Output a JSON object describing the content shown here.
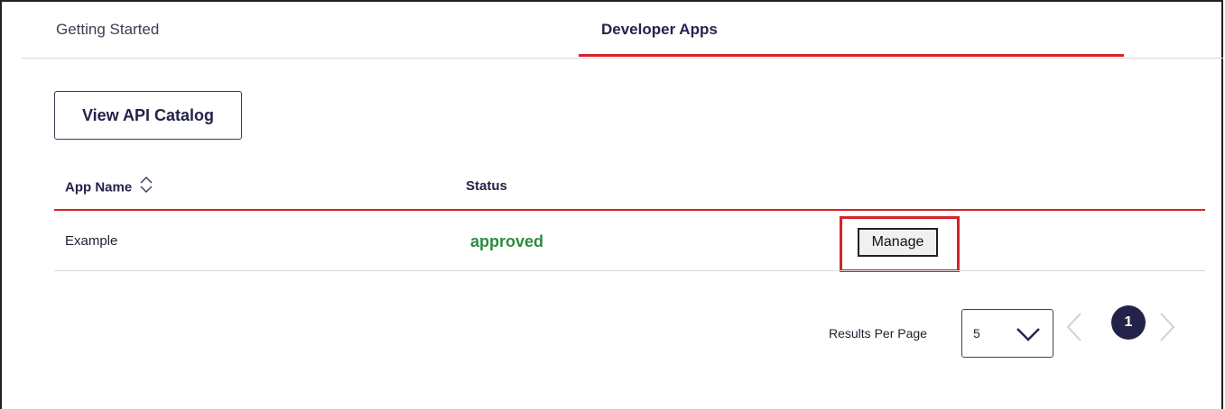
{
  "tabs": [
    {
      "label": "Getting Started",
      "active": false
    },
    {
      "label": "Developer Apps",
      "active": true
    }
  ],
  "catalog_button": "View API Catalog",
  "table": {
    "headers": {
      "app_name": "App Name",
      "status": "Status"
    },
    "rows": [
      {
        "app_name": "Example",
        "status": "approved",
        "action": "Manage"
      }
    ]
  },
  "pagination": {
    "results_per_page_label": "Results Per Page",
    "results_per_page_value": "5",
    "current_page": "1"
  },
  "icons": {
    "sort": "sort-up-down-icon",
    "dropdown": "chevron-down-icon",
    "prev": "chevron-left-icon",
    "next": "chevron-right-icon"
  },
  "colors": {
    "accent": "#d6232a",
    "navy": "#23234a",
    "approved": "#2e8b3e"
  }
}
